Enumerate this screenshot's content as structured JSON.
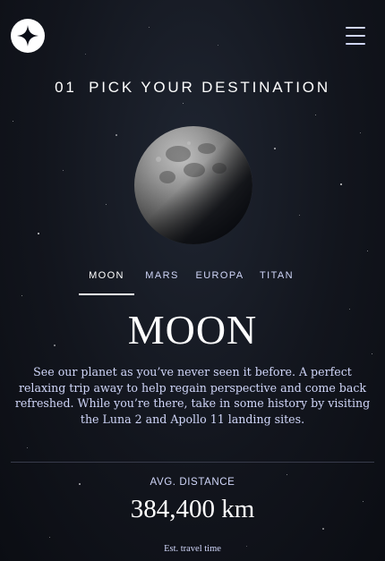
{
  "header": {
    "logo_icon": "star-logo-icon",
    "menu_icon": "hamburger-menu-icon"
  },
  "page": {
    "step_number": "01",
    "heading": "PICK YOUR DESTINATION"
  },
  "destination": {
    "image": "moon-image",
    "tabs": [
      {
        "label": "MOON",
        "active": true
      },
      {
        "label": "MARS",
        "active": false
      },
      {
        "label": "EUROPA",
        "active": false
      },
      {
        "label": "TITAN",
        "active": false
      }
    ],
    "name": "MOON",
    "description": "See our planet as you’ve never seen it before. A perfect relaxing trip away to help regain perspective and come back refreshed. While you’re there, take in some history by visiting the Luna 2 and Apollo 11 landing sites.",
    "stats": {
      "distance_label": "AVG. DISTANCE",
      "distance_value": "384,400 km",
      "travel_label": "Est. travel time"
    }
  },
  "colors": {
    "background": "#0b0d13",
    "accent_text": "#d0d6f9",
    "white": "#ffffff"
  }
}
